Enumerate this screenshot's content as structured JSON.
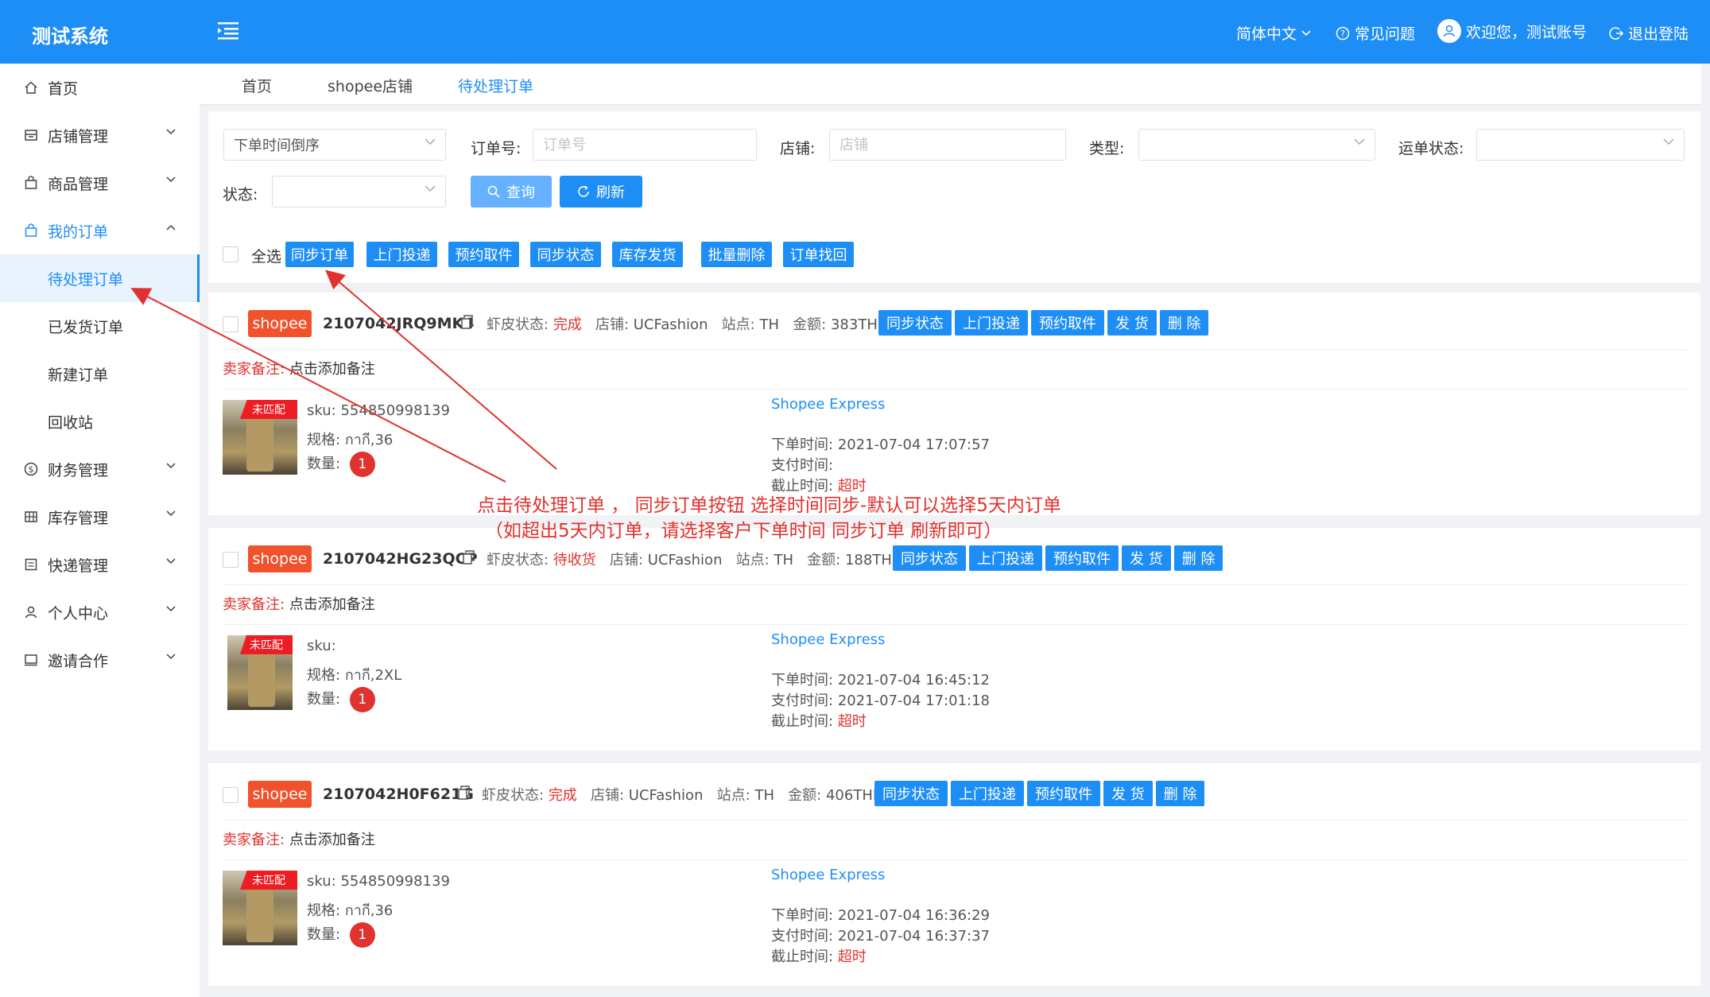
{
  "app": {
    "title": "测试系统"
  },
  "header": {
    "language": "简体中文",
    "faq": "常见问题",
    "welcome": "欢迎您，测试账号",
    "logout": "退出登陆"
  },
  "sidebar": {
    "items": [
      {
        "label": "首页",
        "icon": "home-icon"
      },
      {
        "label": "店铺管理",
        "icon": "store-icon"
      },
      {
        "label": "商品管理",
        "icon": "bag-icon"
      },
      {
        "label": "我的订单",
        "icon": "bag-icon"
      },
      {
        "label": "财务管理",
        "icon": "dollar-icon"
      },
      {
        "label": "库存管理",
        "icon": "grid-icon"
      },
      {
        "label": "快递管理",
        "icon": "list-icon"
      },
      {
        "label": "个人中心",
        "icon": "user-icon"
      },
      {
        "label": "邀请合作",
        "icon": "monitor-icon"
      }
    ],
    "order_sub": [
      "待处理订单",
      "已发货订单",
      "新建订单",
      "回收站"
    ]
  },
  "tabs": [
    "首页",
    "shopee店铺",
    "待处理订单"
  ],
  "filters": {
    "sort_value": "下单时间倒序",
    "order_no_label": "订单号:",
    "order_no_placeholder": "订单号",
    "store_label": "店铺:",
    "store_placeholder": "店铺",
    "type_label": "类型:",
    "waybill_label": "运单状态:",
    "status_label": "状态:",
    "query_btn": "查询",
    "refresh_btn": "刷新"
  },
  "bulk": {
    "select_all": "全选",
    "buttons": [
      "同步订单",
      "上门投递",
      "预约取件",
      "同步状态",
      "库存发货",
      "批量删除",
      "订单找回"
    ]
  },
  "order_labels": {
    "platform": "shopee",
    "shop_status": "虾皮状态:",
    "store": "店铺:",
    "site": "站点:",
    "amount": "金额:",
    "note_key": "卖家备注:",
    "note_value": "点击添加备注",
    "sku": "sku:",
    "spec": "规格:",
    "qty": "数量:",
    "unmatched": "未匹配",
    "order_time": "下单时间:",
    "pay_time": "支付时间:",
    "deadline": "截止时间:",
    "row_buttons": [
      "同步状态",
      "上门投递",
      "预约取件",
      "发 货",
      "删 除"
    ]
  },
  "orders": [
    {
      "order_no": "2107042JRQ9MK4",
      "shop_status": "完成",
      "store": "UCFashion",
      "site": "TH",
      "amount": "383THB",
      "sku": "554850998139",
      "spec": "กากี,36",
      "qty": "1",
      "shipping": "Shopee Express",
      "order_time": "2021-07-04 17:07:57",
      "pay_time": "",
      "deadline": "超时"
    },
    {
      "order_no": "2107042HG23QCP",
      "shop_status": "待收货",
      "store": "UCFashion",
      "site": "TH",
      "amount": "188THB",
      "sku": "",
      "spec": "กากี,2XL",
      "qty": "1",
      "shipping": "Shopee Express",
      "order_time": "2021-07-04 16:45:12",
      "pay_time": "2021-07-04 17:01:18",
      "deadline": "超时"
    },
    {
      "order_no": "2107042H0F621G",
      "shop_status": "完成",
      "store": "UCFashion",
      "site": "TH",
      "amount": "406THB",
      "sku": "554850998139",
      "spec": "กากี,36",
      "qty": "1",
      "shipping": "Shopee Express",
      "order_time": "2021-07-04 16:36:29",
      "pay_time": "2021-07-04 16:37:37",
      "deadline": "超时"
    }
  ],
  "annotation": {
    "line1": "点击待处理订单 ， 同步订单按钮 选择时间同步-默认可以选择5天内订单",
    "line2": "（如超出5天内订单，请选择客户下单时间 同步订单 刷新即可）"
  },
  "colors": {
    "primary": "#1e8ef7",
    "tag": "#f0522c",
    "danger": "#e0322e"
  }
}
